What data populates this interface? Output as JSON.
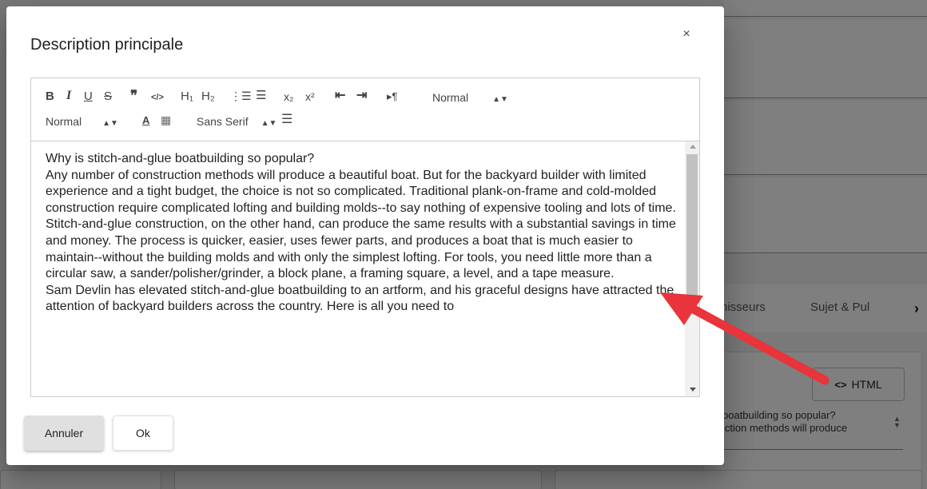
{
  "dialog": {
    "title": "Description principale",
    "close_icon": "×",
    "cancel_label": "Annuler",
    "ok_label": "Ok"
  },
  "toolbar": {
    "bold": "B",
    "italic": "I",
    "underline": "U",
    "strike": "S",
    "blockquote": "❞",
    "code": "</>",
    "h1": "H₁",
    "h2": "H₂",
    "ordered_list": "⋮☰",
    "bullet_list": "☰",
    "subscript": "x₂",
    "superscript": "x²",
    "outdent": "⇤",
    "indent": "⇥",
    "direction": "▸¶",
    "header_select": "Normal",
    "size_select": "Normal",
    "color": "A",
    "background": "▦",
    "font_select": "Sans Serif",
    "align": "☰"
  },
  "content": {
    "paragraphs": [
      "Why is stitch-and-glue boatbuilding so popular?",
      "Any number of construction methods will produce a beautiful boat. But for the backyard builder with limited experience and a tight budget, the choice is not so complicated. Traditional plank-on-frame and cold-molded construction require complicated lofting and building molds--to say nothing of expensive tooling and lots of time. Stitch-and-glue construction, on the other hand, can produce the same results with a substantial savings in time and money. The process is quicker, easier, uses fewer parts, and produces a boat that is much easier to maintain--without the building molds and with only the simplest lofting. For tools, you need little more than a circular saw, a sander/polisher/grinder, a block plane, a framing square, a level, and a tape measure.",
      "Sam Devlin has elevated stitch-and-glue boatbuilding to an artform, and his graceful designs have attracted the attention of backyard builders across the country. Here is all you need to"
    ]
  },
  "background": {
    "tab_1": "nisseurs",
    "tab_2": "Sujet & Pul",
    "tab_chevron": "›",
    "html_button": "HTML",
    "html_code_icon": "<>",
    "textarea_line_1": "boatbuilding so popular?",
    "textarea_line_2": "iction methods will produce"
  },
  "colors": {
    "annotation_arrow": "#e8343a",
    "overlay": "rgba(0,0,0,0.5)"
  }
}
